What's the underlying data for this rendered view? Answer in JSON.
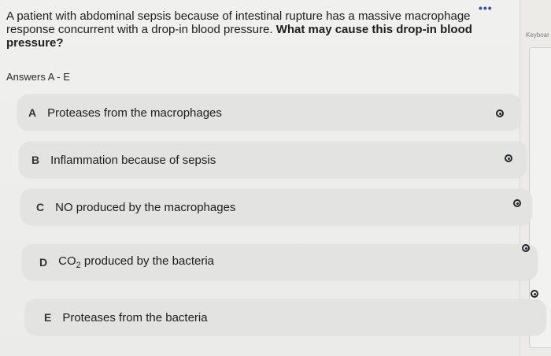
{
  "header": {
    "more_icon": "•••"
  },
  "question": {
    "text_plain": "A patient with abdominal sepsis because of intestinal rupture has a massive macrophage response concurrent with a drop-in blood pressure.",
    "text_bold": "What may cause this drop-in blood pressure?"
  },
  "answers_label": "Answers A - E",
  "options": [
    {
      "letter": "A",
      "text": "Proteases from the macrophages"
    },
    {
      "letter": "B",
      "text": "Inflammation because of sepsis"
    },
    {
      "letter": "C",
      "text": "NO produced by the macrophages"
    },
    {
      "letter": "D",
      "text_pre": "CO",
      "text_sub": "2",
      "text_post": " produced by the bacteria"
    },
    {
      "letter": "E",
      "text": "Proteases from the bacteria"
    }
  ],
  "side_panel": {
    "keyboard_label": "Keyboar"
  }
}
